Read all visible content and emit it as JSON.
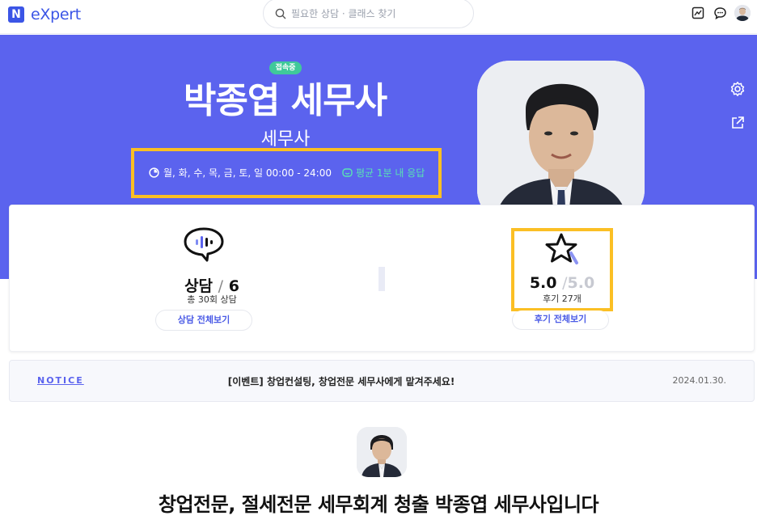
{
  "header": {
    "logo_mark": "N",
    "logo_text": "eXpert",
    "search_placeholder": "필요한 상담 · 클래스 찾기",
    "icons": [
      "chart-board-icon",
      "chat-icon",
      "profile-avatar"
    ]
  },
  "profile": {
    "status_badge": "접속중",
    "name": "박종엽 세무사",
    "role": "세무사",
    "hours": "월, 화, 수, 목, 금, 토, 일 00:00 - 24:00",
    "response": "평균 1분 내 응답"
  },
  "stats": {
    "consult_label": "상담",
    "consult_sep": "/",
    "consult_value": "6",
    "consult_total": "총 30회 상담",
    "consult_button": "상담 전체보기",
    "rating_value": "5.0",
    "rating_sep": "/",
    "rating_max": "5.0",
    "review_count": "후기 27개",
    "review_button": "후기 전체보기"
  },
  "notice": {
    "label": "NOTICE",
    "title": "[이벤트] 창업컨설팅, 창업전문 세무사에게 맡겨주세요!",
    "date": "2024.01.30."
  },
  "intro": {
    "title": "창업전문, 절세전문 세무회계 청출 박종엽 세무사입니다"
  },
  "colors": {
    "hero": "#5b63ee",
    "brand": "#3b55e6",
    "online": "#40c99a",
    "highlight": "#fbbf24"
  }
}
